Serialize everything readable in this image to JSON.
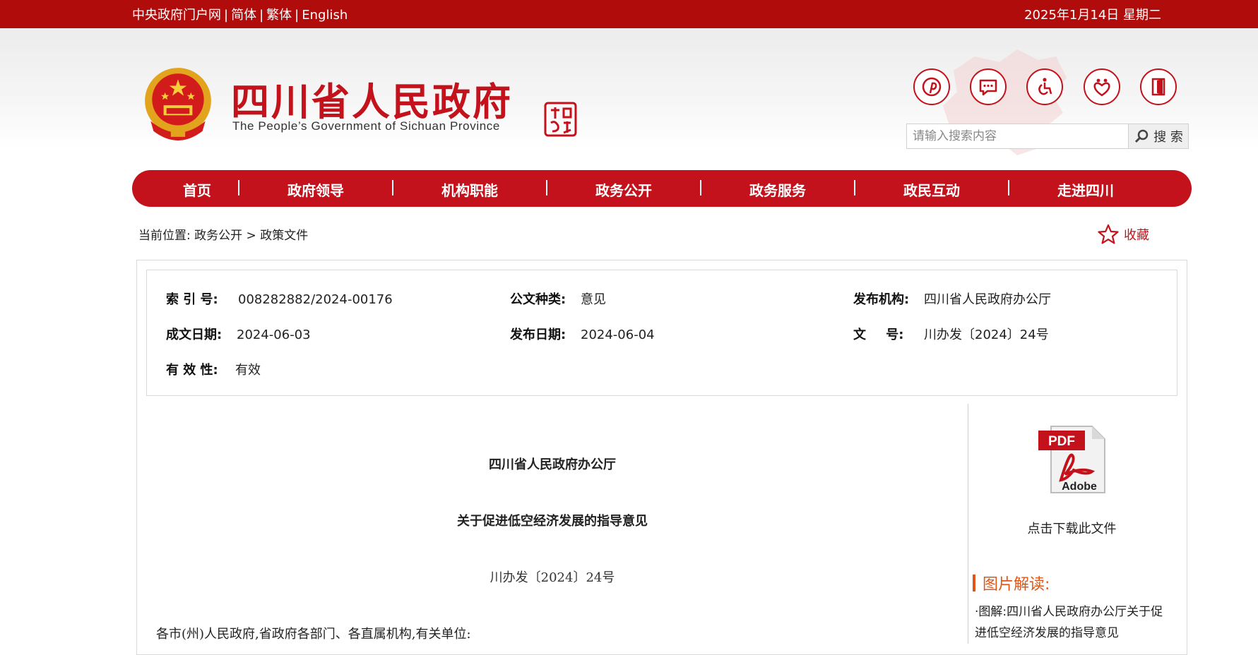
{
  "topbar": {
    "links": [
      "中央政府门户网",
      "简体",
      "繁体",
      "English"
    ],
    "separator": "|",
    "date": "2025年1月14日 星期二"
  },
  "header": {
    "title": "四川省人民政府",
    "subtitle": "The People’s Government of Sichuan Province",
    "seal_text": "中国四川"
  },
  "search": {
    "placeholder": "请输入搜索内容",
    "button_label": "搜 索"
  },
  "nav": {
    "items": [
      "首页",
      "政府领导",
      "机构职能",
      "政务公开",
      "政务服务",
      "政民互动",
      "走进四川"
    ]
  },
  "breadcrumb": {
    "prefix": "当前位置:",
    "items": [
      "政务公开",
      "政策文件"
    ],
    "separator": ">"
  },
  "favorite": {
    "label": "收藏"
  },
  "meta": {
    "index_label": "索 引 号:",
    "index_value": "008282882/2024-00176",
    "category_label": "公文种类:",
    "category_value": "意见",
    "publisher_label": "发布机构:",
    "publisher_value": "四川省人民政府办公厅",
    "written_label": "成文日期:",
    "written_value": "2024-06-03",
    "published_label": "发布日期:",
    "published_value": "2024-06-04",
    "docno_label": "文 号:",
    "docno_value": "川办发〔2024〕24号",
    "validity_label": "有 效 性:",
    "validity_value": "有效"
  },
  "document": {
    "issuer": "四川省人民政府办公厅",
    "title": "关于促进低空经济发展的指导意见",
    "number": "川办发〔2024〕24号",
    "salutation": "各市(州)人民政府,省政府各部门、各直属机构,有关单位:"
  },
  "sidebar": {
    "pdf_badge": "PDF",
    "pdf_brand": "Adobe",
    "download_label": "点击下载此文件",
    "pic_heading": "图片解读:",
    "pic_link": "·图解:四川省人民政府办公厅关于促进低空经济发展的指导意见"
  },
  "colors": {
    "brand_red": "#c3121b",
    "topbar_red": "#b00c0c",
    "accent_orange": "#e0561a"
  },
  "icons": [
    "pinterest-icon",
    "message-icon",
    "accessibility-icon",
    "care-mode-icon",
    "exit-icon",
    "search-icon",
    "star-icon",
    "pdf-icon"
  ]
}
